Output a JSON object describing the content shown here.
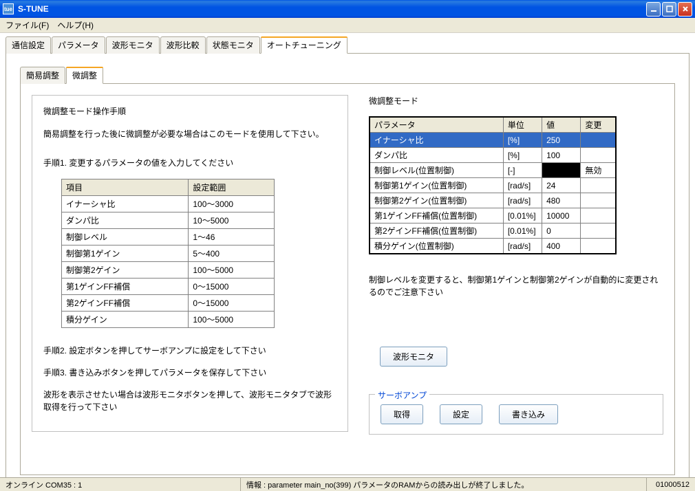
{
  "window": {
    "title": "S-TUNE",
    "icon_text": "tue"
  },
  "menu": {
    "file": "ファイル(F)",
    "help": "ヘルプ(H)"
  },
  "main_tabs": [
    "通信設定",
    "パラメータ",
    "波形モニタ",
    "波形比較",
    "状態モニタ",
    "オートチューニング"
  ],
  "sub_tabs": [
    "簡易調整",
    "微調整"
  ],
  "left": {
    "title": "微調整モード操作手順",
    "intro": "簡易調整を行った後に微調整が必要な場合はこのモードを使用して下さい。",
    "step1": "手順1. 変更するパラメータの値を入力してください",
    "step2": "手順2. 設定ボタンを押してサーボアンプに設定をして下さい",
    "step3": "手順3. 書き込みボタンを押してパラメータを保存して下さい",
    "note_wave": "波形を表示させたい場合は波形モニタボタンを押して、波形モニタタブで波形取得を行って下さい",
    "spec_headers": {
      "item": "項目",
      "range": "設定範囲"
    },
    "spec_rows": [
      {
        "item": "イナーシャ比",
        "range": "100～3000"
      },
      {
        "item": "ダンパ比",
        "range": "10～5000"
      },
      {
        "item": "制御レベル",
        "range": "1～46"
      },
      {
        "item": "制御第1ゲイン",
        "range": "5～400"
      },
      {
        "item": "制御第2ゲイン",
        "range": "100～5000"
      },
      {
        "item": "第1ゲインFF補償",
        "range": "0～15000"
      },
      {
        "item": "第2ゲインFF補償",
        "range": "0～15000"
      },
      {
        "item": "積分ゲイン",
        "range": "100～5000"
      }
    ]
  },
  "right": {
    "title": "微調整モード",
    "headers": {
      "param": "パラメータ",
      "unit": "単位",
      "value": "値",
      "change": "変更"
    },
    "rows": [
      {
        "param": "イナーシャ比",
        "unit": "[%]",
        "value": "250",
        "change": "",
        "selected": true
      },
      {
        "param": "ダンパ比",
        "unit": "[%]",
        "value": "100",
        "change": ""
      },
      {
        "param": "制御レベル(位置制御)",
        "unit": "[-]",
        "value": "",
        "change": "無効",
        "black": true
      },
      {
        "param": "制御第1ゲイン(位置制御)",
        "unit": "[rad/s]",
        "value": "24",
        "change": ""
      },
      {
        "param": "制御第2ゲイン(位置制御)",
        "unit": "[rad/s]",
        "value": "480",
        "change": ""
      },
      {
        "param": "第1ゲインFF補償(位置制御)",
        "unit": "[0.01%]",
        "value": "10000",
        "change": ""
      },
      {
        "param": "第2ゲインFF補償(位置制御)",
        "unit": "[0.01%]",
        "value": "0",
        "change": ""
      },
      {
        "param": "積分ゲイン(位置制御)",
        "unit": "[rad/s]",
        "value": "400",
        "change": ""
      }
    ],
    "note": "制御レベルを変更すると、制御第1ゲインと制御第2ゲインが自動的に変更されるのでご注意下さい",
    "wave_btn": "波形モニタ",
    "group_legend": "サーボアンプ",
    "btn_get": "取得",
    "btn_set": "設定",
    "btn_write": "書き込み"
  },
  "status": {
    "left": "オンライン COM35 : 1",
    "mid": "情報 : parameter main_no(399) パラメータのRAMからの読み出しが終了しました。",
    "right": "01000512"
  }
}
